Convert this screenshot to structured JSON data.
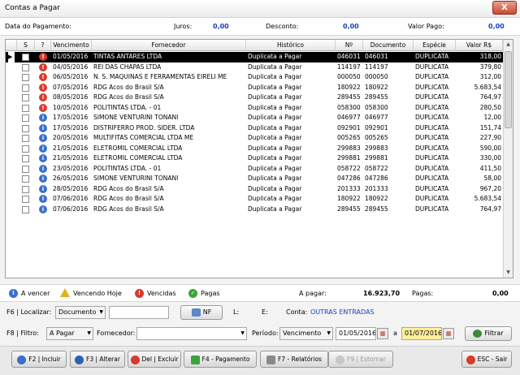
{
  "window": {
    "title": "Contas a Pagar",
    "close_label": "X"
  },
  "summary": {
    "date_label": "Data do Pagamento:",
    "juros_label": "Juros:",
    "juros_value": "0,00",
    "desconto_label": "Desconto:",
    "desconto_value": "0,00",
    "valor_pago_label": "Valor Pago:",
    "valor_pago_value": "0,00"
  },
  "grid": {
    "headers": [
      "S",
      "?",
      "Vencimento",
      "Fornecedor",
      "Histórico",
      "Nº",
      "Documento",
      "Espécie",
      "Valor R$"
    ],
    "rows": [
      {
        "status": "red",
        "venc": "01/05/2016",
        "forn": "TINTAS ANTARES LTDA",
        "hist": "Duplicata a Pagar",
        "nf": "046031",
        "doc": "046031",
        "esp": "DUPLICATA",
        "valor": "318,00"
      },
      {
        "status": "red",
        "venc": "04/05/2016",
        "forn": "REI DAS CHAPAS LTDA",
        "hist": "Duplicata a Pagar",
        "nf": "114197",
        "doc": "114197",
        "esp": "DUPLICATA",
        "valor": "379,80"
      },
      {
        "status": "red",
        "venc": "06/05/2016",
        "forn": "N. S. MAQUINAS E FERRAMENTAS EIRELI ME",
        "hist": "Duplicata a Pagar",
        "nf": "000050",
        "doc": "000050",
        "esp": "DUPLICATA",
        "valor": "312,00"
      },
      {
        "status": "red",
        "venc": "07/05/2016",
        "forn": "RDG Acos do Brasil S/A",
        "hist": "Duplicata a Pagar",
        "nf": "180922",
        "doc": "180922",
        "esp": "DUPLICATA",
        "valor": "5.683,54"
      },
      {
        "status": "red",
        "venc": "08/05/2016",
        "forn": "RDG Acos do Brasil S/A",
        "hist": "Duplicata a Pagar",
        "nf": "289455",
        "doc": "289455",
        "esp": "DUPLICATA",
        "valor": "764,97"
      },
      {
        "status": "red",
        "venc": "10/05/2016",
        "forn": "POLITINTAS LTDA. - 01",
        "hist": "Duplicata a Pagar",
        "nf": "058300",
        "doc": "058300",
        "esp": "DUPLICATA",
        "valor": "280,50"
      },
      {
        "status": "blue",
        "venc": "17/05/2016",
        "forn": "SIMONE VENTURINI TONANI",
        "hist": "Duplicata a Pagar",
        "nf": "046977",
        "doc": "046977",
        "esp": "DUPLICATA",
        "valor": "12,00"
      },
      {
        "status": "blue",
        "venc": "17/05/2016",
        "forn": "DISTRIFERRO PROD. SIDER. LTDA",
        "hist": "Duplicata a Pagar",
        "nf": "092901",
        "doc": "092901",
        "esp": "DUPLICATA",
        "valor": "151,74"
      },
      {
        "status": "blue",
        "venc": "20/05/2016",
        "forn": "MULTIFITAS COMERCIAL LTDA ME",
        "hist": "Duplicata a Pagar",
        "nf": "005265",
        "doc": "005265",
        "esp": "DUPLICATA",
        "valor": "227,90"
      },
      {
        "status": "blue",
        "venc": "21/05/2016",
        "forn": "ELETROMIL COMERCIAL LTDA",
        "hist": "Duplicata a Pagar",
        "nf": "299883",
        "doc": "299883",
        "esp": "DUPLICATA",
        "valor": "590,00"
      },
      {
        "status": "blue",
        "venc": "21/05/2016",
        "forn": "ELETROMIL COMERCIAL LTDA",
        "hist": "Duplicata a Pagar",
        "nf": "299881",
        "doc": "299881",
        "esp": "DUPLICATA",
        "valor": "330,00"
      },
      {
        "status": "blue",
        "venc": "23/05/2016",
        "forn": "POLITINTAS LTDA. - 01",
        "hist": "Duplicata a Pagar",
        "nf": "058722",
        "doc": "058722",
        "esp": "DUPLICATA",
        "valor": "411,50"
      },
      {
        "status": "blue",
        "venc": "26/05/2016",
        "forn": "SIMONE VENTURINI TONANI",
        "hist": "Duplicata a Pagar",
        "nf": "047286",
        "doc": "047286",
        "esp": "DUPLICATA",
        "valor": "58,00"
      },
      {
        "status": "blue",
        "venc": "28/05/2016",
        "forn": "RDG Acos do Brasil S/A",
        "hist": "Duplicata a Pagar",
        "nf": "201333",
        "doc": "201333",
        "esp": "DUPLICATA",
        "valor": "967,20"
      },
      {
        "status": "blue",
        "venc": "07/06/2016",
        "forn": "RDG Acos do Brasil S/A",
        "hist": "Duplicata a Pagar",
        "nf": "180922",
        "doc": "180922",
        "esp": "DUPLICATA",
        "valor": "5.683,54"
      },
      {
        "status": "blue",
        "venc": "07/06/2016",
        "forn": "RDG Acos do Brasil S/A",
        "hist": "Duplicata a Pagar",
        "nf": "289455",
        "doc": "289455",
        "esp": "DUPLICATA",
        "valor": "764,97"
      }
    ]
  },
  "legend": {
    "a_vencer": "A vencer",
    "vencendo_hoje": "Vencendo Hoje",
    "vencidas": "Vencidas",
    "pagas": "Pagas",
    "a_pagar_label": "A pagar:",
    "a_pagar_value": "16.923,70",
    "pagas_label": "Pagas:",
    "pagas_value": "0,00"
  },
  "localizar": {
    "label": "F6 | Localizar:",
    "select": "Documento",
    "input": "",
    "nf_button": "NF",
    "l_label": "L:",
    "e_label": "E:",
    "conta_label": "Conta:",
    "conta_value": "OUTRAS ENTRADAS"
  },
  "filtro": {
    "label": "F8 | Filtro:",
    "select": "A Pagar",
    "fornecedor_label": "Fornecedor:",
    "fornecedor_value": "",
    "periodo_label": "Período:",
    "periodo_select": "Vencimento",
    "date_from": "01/05/2016",
    "a_label": "a",
    "date_to": "01/07/2016",
    "filtrar_button": "Filtrar"
  },
  "footer": {
    "incluir": "F2 | Incluir",
    "alterar": "F3 | Alterar",
    "excluir": "Del | Excluir",
    "pagamento": "F4 - Pagamento",
    "relatorios": "F7 - Relatórios",
    "estornar": "F9 | Estornar",
    "sair": "ESC - Sair"
  },
  "colors": {
    "selected_row": "#000000",
    "value_blue": "#1a3dbf",
    "vencida_red": "#d63b2b",
    "avencer_blue": "#3b6fc9",
    "paga_green": "#3aa33a",
    "hoje_yellow": "#e0b020"
  }
}
